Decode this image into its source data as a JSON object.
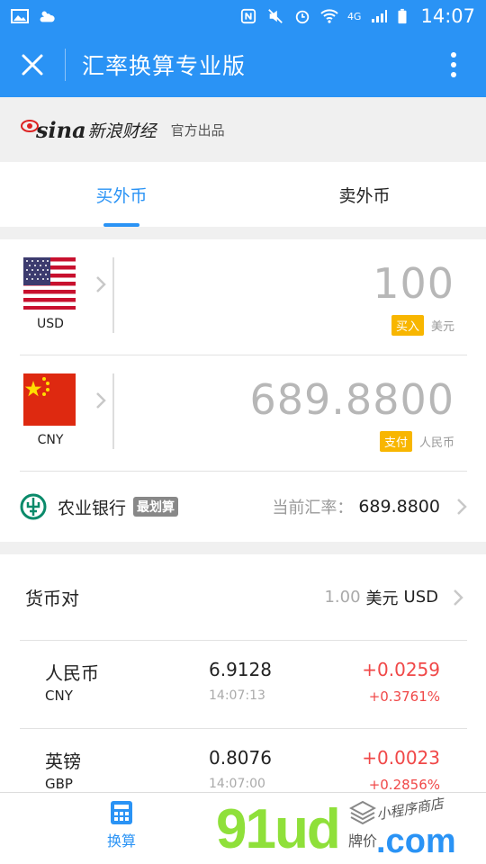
{
  "status_bar": {
    "time": "14:07",
    "network": "4G"
  },
  "header": {
    "title": "汇率换算专业版"
  },
  "brand": {
    "logo_text": "sina",
    "name": "新浪财经",
    "official": "官方出品"
  },
  "tabs": [
    {
      "label": "买外币",
      "active": true
    },
    {
      "label": "卖外币",
      "active": false
    }
  ],
  "converter": {
    "from": {
      "code": "USD",
      "amount": "100",
      "badge": "买入",
      "unit": "美元"
    },
    "to": {
      "code": "CNY",
      "amount": "689.8800",
      "badge": "支付",
      "unit": "人民币"
    },
    "bank": {
      "name": "农业银行",
      "badge": "最划算",
      "rate_label": "当前汇率：",
      "rate_value": "689.8800"
    }
  },
  "pairs": {
    "title": "货币对",
    "base_qty": "1.00",
    "base_unit": "美元",
    "base_code": "USD",
    "rows": [
      {
        "name": "人民币",
        "code": "CNY",
        "rate": "6.9128",
        "time": "14:07:13",
        "change": "+0.0259",
        "percent": "+0.3761%"
      },
      {
        "name": "英镑",
        "code": "GBP",
        "rate": "0.8076",
        "time": "14:07:00",
        "change": "+0.0023",
        "percent": "+0.2856%"
      }
    ]
  },
  "bottom_nav": [
    {
      "label": "换算",
      "icon": "calculator-icon",
      "active": true
    },
    {
      "label": "牌价",
      "icon": "layers-icon",
      "active": false
    }
  ],
  "watermark": {
    "main": "91ud",
    "suffix": ".com",
    "small": "小程序商店"
  },
  "colors": {
    "primary": "#2a93f5",
    "up": "#f04848",
    "badge": "#f8b600"
  }
}
